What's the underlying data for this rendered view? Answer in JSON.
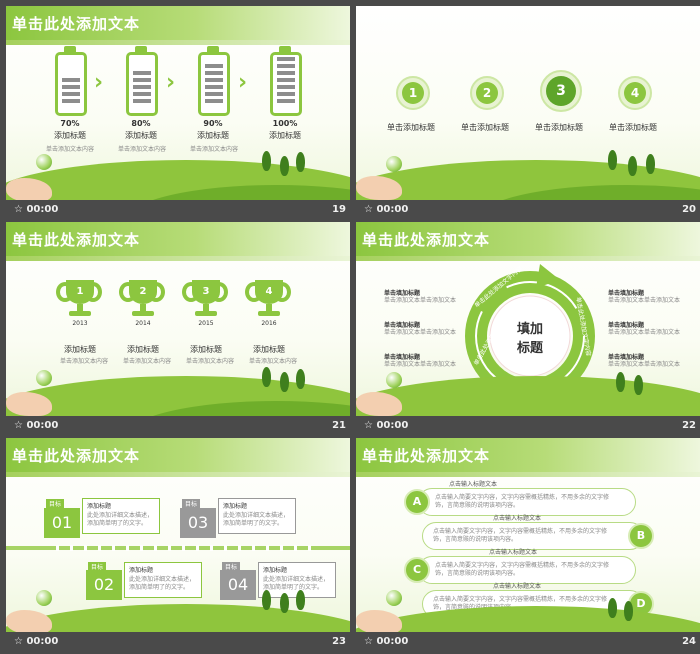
{
  "footer_time": "00:00",
  "slides": [
    {
      "number": "19",
      "title": "单击此处添加文本",
      "items": [
        {
          "percent": "70%",
          "label": "添加标题",
          "level": 0.7
        },
        {
          "percent": "80%",
          "label": "添加标题",
          "level": 0.8
        },
        {
          "percent": "90%",
          "label": "添加标题",
          "level": 0.9
        },
        {
          "percent": "100%",
          "label": "添加标题",
          "level": 1.0
        }
      ],
      "body_text": "单击添加文本内容"
    },
    {
      "number": "20",
      "steps": [
        {
          "num": "1",
          "label": "单击添加标题"
        },
        {
          "num": "2",
          "label": "单击添加标题"
        },
        {
          "num": "3",
          "label": "单击添加标题"
        },
        {
          "num": "4",
          "label": "单击添加标题"
        }
      ]
    },
    {
      "number": "21",
      "title": "单击此处添加文本",
      "trophies": [
        {
          "num": "1",
          "year": "2013",
          "label": "添加标题"
        },
        {
          "num": "2",
          "year": "2014",
          "label": "添加标题"
        },
        {
          "num": "3",
          "year": "2015",
          "label": "添加标题"
        },
        {
          "num": "4",
          "year": "2016",
          "label": "添加标题"
        }
      ],
      "body_text": "单击添加文本内容"
    },
    {
      "number": "22",
      "title": "单击此处添加文本",
      "center_label_1": "填加",
      "center_label_2": "标题",
      "ring_text_left": "单击此处添加文字内容",
      "ring_text_right": "单击此处添加文字内容",
      "ring_text_top": "单击此处添加文字内容",
      "side_title": "单击填加标题",
      "side_text": "单击添加文本单击添加文本"
    },
    {
      "number": "23",
      "title": "单击此处添加文本",
      "tag": "目标",
      "boxes": [
        {
          "num": "01",
          "title": "添加标题",
          "text": "此处添加详细文本描述，添加简单明了的文字。"
        },
        {
          "num": "03",
          "title": "添加标题",
          "text": "此处添加详细文本描述，添加简单明了的文字。"
        },
        {
          "num": "02",
          "title": "添加标题",
          "text": "此处添加详细文本描述，添加简单明了的文字。"
        },
        {
          "num": "04",
          "title": "添加标题",
          "text": "此处添加详细文本描述，添加简单明了的文字。"
        }
      ]
    },
    {
      "number": "24",
      "title": "单击此处添加文本",
      "pills": [
        {
          "letter": "A",
          "head": "点击输入标题文本",
          "text": "点击输入简要文字内容，文字内容需概括精炼，不用多余的文字修饰，言简意赅的说明该项内容。"
        },
        {
          "letter": "B",
          "head": "点击输入标题文本",
          "text": "点击输入简要文字内容，文字内容需概括精炼，不用多余的文字修饰，言简意赅的说明该项内容。"
        },
        {
          "letter": "C",
          "head": "点击输入标题文本",
          "text": "点击输入简要文字内容，文字内容需概括精炼，不用多余的文字修饰，言简意赅的说明该项内容。"
        },
        {
          "letter": "D",
          "head": "点击输入标题文本",
          "text": "点击输入简要文字内容，文字内容需概括精炼，不用多余的文字修饰，言简意赅的说明该项内容。"
        }
      ]
    }
  ]
}
